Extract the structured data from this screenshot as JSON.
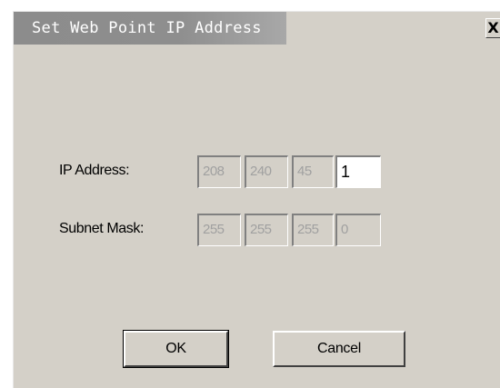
{
  "window": {
    "title": "Set Web Point IP Address",
    "close_glyph": "X"
  },
  "ip_address": {
    "label": "IP Address:",
    "octets": [
      "208",
      "240",
      "45",
      "1"
    ]
  },
  "subnet_mask": {
    "label": "Subnet Mask:",
    "octets": [
      "255",
      "255",
      "255",
      "0"
    ]
  },
  "buttons": {
    "ok_label": "OK",
    "cancel_label": "Cancel"
  }
}
